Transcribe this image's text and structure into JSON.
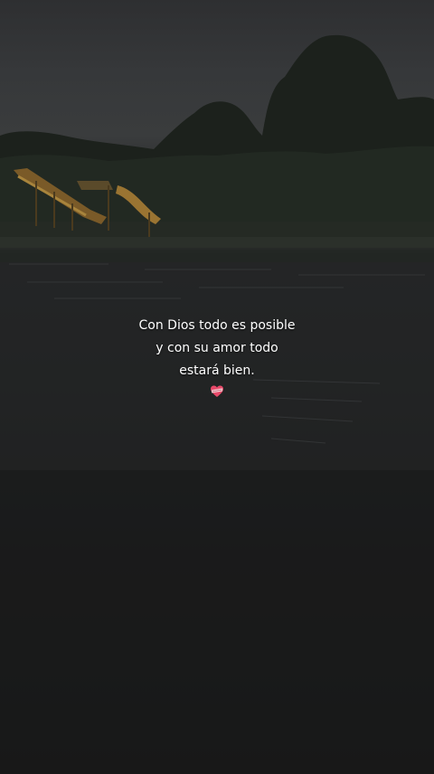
{
  "caption": {
    "line1": "Con Dios todo es posible",
    "line2": "y con su amor todo",
    "line3": "estará bien.",
    "emoji": "heart-ribbon-icon"
  },
  "colors": {
    "sky": "#37393b",
    "water": "#1c1c1d",
    "trees": "#1a1d19",
    "slide": "#8a6a2e",
    "text": "#ffffff",
    "heart": "#e84a6a"
  }
}
